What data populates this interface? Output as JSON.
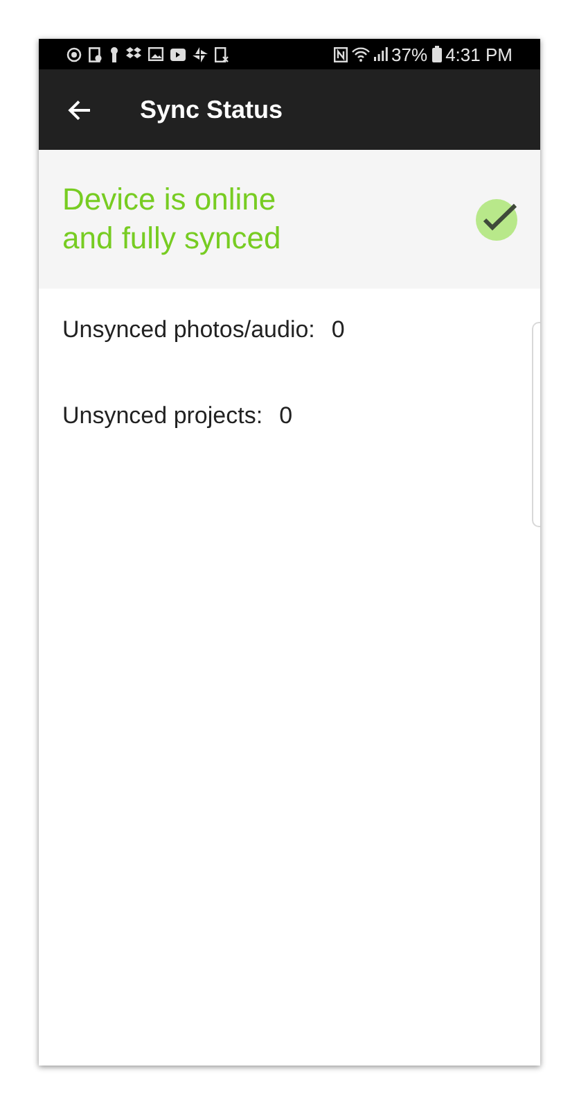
{
  "status_bar": {
    "battery": "37%",
    "time": "4:31 PM"
  },
  "app_bar": {
    "title": "Sync Status"
  },
  "sync_state": {
    "message": "Device is online\nand fully synced",
    "synced": true
  },
  "counts": [
    {
      "label": "Unsynced photos/audio:",
      "value": "0"
    },
    {
      "label": "Unsynced projects:",
      "value": "0"
    }
  ]
}
